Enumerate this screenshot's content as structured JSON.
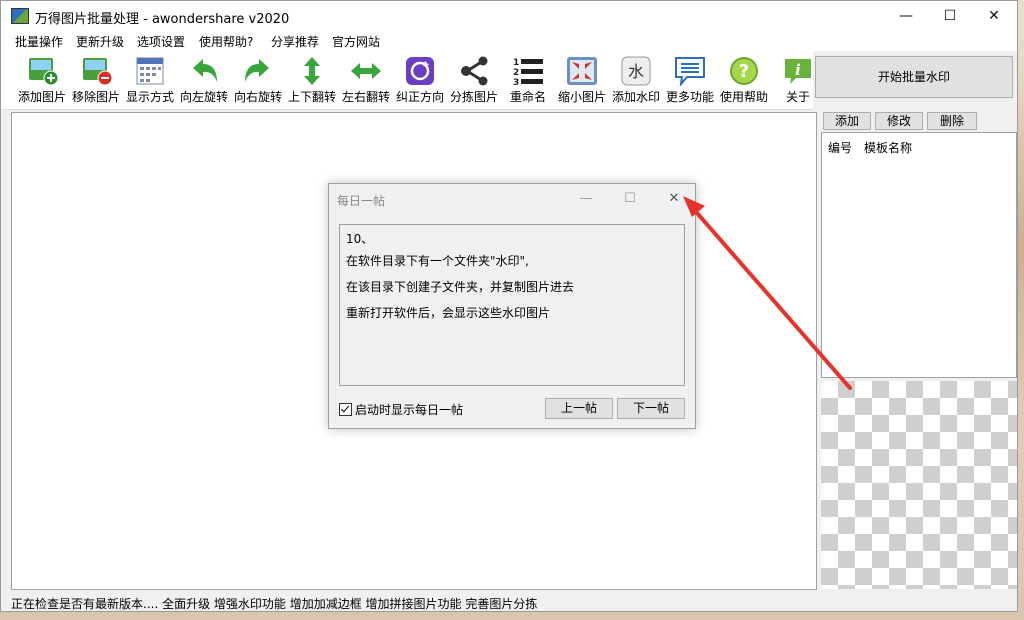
{
  "window": {
    "title": "万得图片批量处理 - awondershare v2020"
  },
  "menu": [
    "批量操作",
    "更新升级",
    "选项设置",
    "使用帮助?",
    "分享推荐",
    "官方网站"
  ],
  "toolbar": [
    {
      "label": "添加图片",
      "icon": "add-image-icon"
    },
    {
      "label": "移除图片",
      "icon": "remove-image-icon"
    },
    {
      "label": "显示方式",
      "icon": "calendar-view-icon"
    },
    {
      "label": "向左旋转",
      "icon": "rotate-left-icon"
    },
    {
      "label": "向右旋转",
      "icon": "rotate-right-icon"
    },
    {
      "label": "上下翻转",
      "icon": "flip-vertical-icon"
    },
    {
      "label": "左右翻转",
      "icon": "flip-horizontal-icon"
    },
    {
      "label": "纠正方向",
      "icon": "correct-orientation-icon"
    },
    {
      "label": "分拣图片",
      "icon": "share-sort-icon"
    },
    {
      "label": "重命名",
      "icon": "numbered-list-icon"
    },
    {
      "label": "缩小图片",
      "icon": "shrink-image-icon"
    },
    {
      "label": "添加水印",
      "icon": "watermark-icon"
    },
    {
      "label": "更多功能",
      "icon": "chat-bubble-icon"
    },
    {
      "label": "使用帮助",
      "icon": "help-icon"
    },
    {
      "label": "关于",
      "icon": "info-icon"
    }
  ],
  "start_button": "开始批量水印",
  "right_panel": {
    "add": "添加",
    "edit": "修改",
    "delete": "删除",
    "col_id": "编号",
    "col_name": "模板名称"
  },
  "status": "正在检查是否有最新版本.... 全面升级 增强水印功能 增加加减边框 增加拼接图片功能 完善图片分拣",
  "dialog": {
    "title": "每日一帖",
    "lines": [
      "10、",
      "在软件目录下有一个文件夹\"水印\",",
      "在该目录下创建子文件夹，并复制图片进去",
      "重新打开软件后，会显示这些水印图片"
    ],
    "checkbox": "启动时显示每日一帖",
    "prev": "上一帖",
    "next": "下一帖"
  },
  "colors": {
    "accent_arrow": "#e8332b"
  }
}
